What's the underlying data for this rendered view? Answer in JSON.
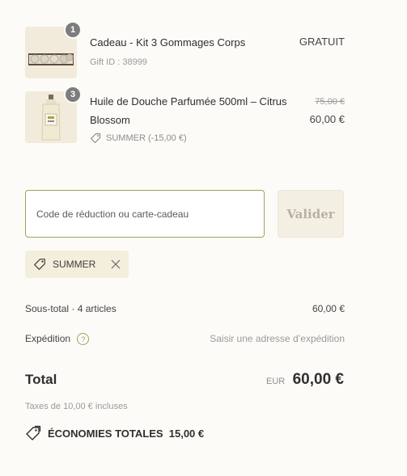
{
  "items": [
    {
      "quantity": "1",
      "title": "Cadeau - Kit 3 Gommages Corps",
      "gift_id": "Gift ID : 38999",
      "price": "GRATUIT"
    },
    {
      "quantity": "3",
      "title_line1": "Huile de Douche Parfumée 500ml – Citrus",
      "title_line2": "Blossom",
      "discount": "SUMMER (-15,00 €)",
      "old_price": "75,00 €",
      "price": "60,00 €"
    }
  ],
  "discount_form": {
    "placeholder": "Code de réduction ou carte-cadeau",
    "button_label": "Valider"
  },
  "applied_code": "SUMMER",
  "summary": {
    "subtotal_label": "Sous-total · 4 articles",
    "subtotal_value": "60,00 €",
    "shipping_label": "Expédition",
    "shipping_value": "Saisir une adresse d’expédition",
    "total_label": "Total",
    "currency": "EUR",
    "total_value": "60,00 €",
    "taxes": "Taxes de 10,00 € incluses",
    "savings": "ÉCONOMIES TOTALES  15,00 €"
  },
  "colors": {
    "background": "#fcfbf7",
    "accent": "#a4a15c",
    "tag_bg": "#f4eedd"
  }
}
